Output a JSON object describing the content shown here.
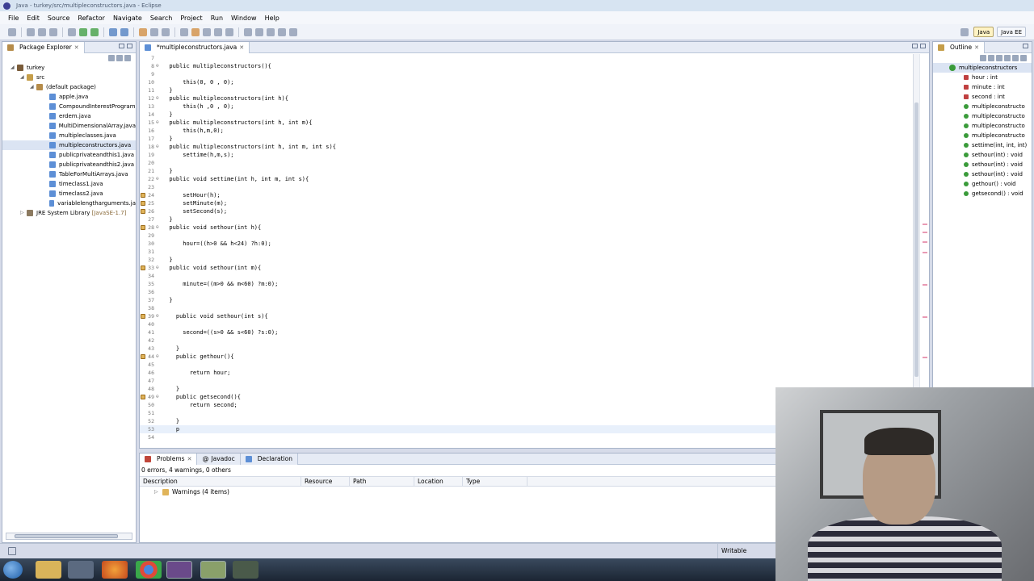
{
  "window": {
    "title": "Java - turkey/src/multipleconstructors.java - Eclipse"
  },
  "menu": [
    "File",
    "Edit",
    "Source",
    "Refactor",
    "Navigate",
    "Search",
    "Project",
    "Run",
    "Window",
    "Help"
  ],
  "perspectives": {
    "java": "Java",
    "javaee": "Java EE"
  },
  "package_explorer": {
    "tab": "Package Explorer",
    "project": "turkey",
    "src": "src",
    "default_package": "(default package)",
    "files": [
      "apple.java",
      "CompoundInterestProgram",
      "erdem.java",
      "MultiDimensionalArray.java",
      "multipleclasses.java",
      "multipleconstructors.java",
      "publicprivateandthis1.java",
      "publicprivateandthis2.java",
      "TableForMultiArrays.java",
      "timeclass1.java",
      "timeclass2.java",
      "variablelengtharguments.ja"
    ],
    "selected_index": 5,
    "library": "JRE System Library",
    "library_version": "[JavaSE-1.7]"
  },
  "editor": {
    "tab": "*multipleconstructors.java",
    "lines": [
      {
        "n": "7",
        "t": ""
      },
      {
        "n": "8",
        "t": "  public multipleconstructors(){",
        "fold": true
      },
      {
        "n": "9",
        "t": ""
      },
      {
        "n": "10",
        "t": "      this(0, 0 , 0);"
      },
      {
        "n": "11",
        "t": "  }"
      },
      {
        "n": "12",
        "t": "  public multipleconstructors(int h){",
        "fold": true
      },
      {
        "n": "13",
        "t": "      this(h ,0 , 0);"
      },
      {
        "n": "14",
        "t": "  }"
      },
      {
        "n": "15",
        "t": "  public multipleconstructors(int h, int m){",
        "fold": true
      },
      {
        "n": "16",
        "t": "      this(h,m,0);"
      },
      {
        "n": "17",
        "t": "  }"
      },
      {
        "n": "18",
        "t": "  public multipleconstructors(int h, int m, int s){",
        "fold": true
      },
      {
        "n": "19",
        "t": "      settime(h,m,s);"
      },
      {
        "n": "20",
        "t": ""
      },
      {
        "n": "21",
        "t": "  }"
      },
      {
        "n": "22",
        "t": "  public void settime(int h, int m, int s){",
        "fold": true
      },
      {
        "n": "23",
        "t": ""
      },
      {
        "n": "24",
        "t": "      setHour(h);",
        "warn": true
      },
      {
        "n": "25",
        "t": "      setMinute(m);",
        "warn": true
      },
      {
        "n": "26",
        "t": "      setSecond(s);",
        "warn": true
      },
      {
        "n": "27",
        "t": "  }"
      },
      {
        "n": "28",
        "t": "  public void sethour(int h){",
        "fold": true,
        "warn": true
      },
      {
        "n": "29",
        "t": ""
      },
      {
        "n": "30",
        "t": "      hour=((h>0 && h<24) ?h:0);"
      },
      {
        "n": "31",
        "t": ""
      },
      {
        "n": "32",
        "t": "  }"
      },
      {
        "n": "33",
        "t": "  public void sethour(int m){",
        "fold": true,
        "warn": true
      },
      {
        "n": "34",
        "t": ""
      },
      {
        "n": "35",
        "t": "      minute=((m>0 && m<60) ?m:0);"
      },
      {
        "n": "36",
        "t": ""
      },
      {
        "n": "37",
        "t": "  }"
      },
      {
        "n": "38",
        "t": ""
      },
      {
        "n": "39",
        "t": "    public void sethour(int s){",
        "fold": true,
        "warn": true
      },
      {
        "n": "40",
        "t": ""
      },
      {
        "n": "41",
        "t": "      second=((s>0 && s<60) ?s:0);"
      },
      {
        "n": "42",
        "t": ""
      },
      {
        "n": "43",
        "t": "    }"
      },
      {
        "n": "44",
        "t": "    public gethour(){",
        "fold": true,
        "warn": true
      },
      {
        "n": "45",
        "t": ""
      },
      {
        "n": "46",
        "t": "        return hour;"
      },
      {
        "n": "47",
        "t": ""
      },
      {
        "n": "48",
        "t": "    }"
      },
      {
        "n": "49",
        "t": "    public getsecond(){",
        "fold": true,
        "warn": true
      },
      {
        "n": "50",
        "t": "        return second;"
      },
      {
        "n": "51",
        "t": ""
      },
      {
        "n": "52",
        "t": "    }"
      },
      {
        "n": "53",
        "t": "    p",
        "current": true
      },
      {
        "n": "54",
        "t": ""
      }
    ]
  },
  "outline": {
    "tab": "Outline",
    "root": "multipleconstructors",
    "items": [
      {
        "label": "hour : int",
        "color": "#c04040"
      },
      {
        "label": "minute : int",
        "color": "#c04040"
      },
      {
        "label": "second : int",
        "color": "#c04040"
      },
      {
        "label": "multipleconstructo",
        "color": "#3a9b3a"
      },
      {
        "label": "multipleconstructo",
        "color": "#3a9b3a"
      },
      {
        "label": "multipleconstructo",
        "color": "#3a9b3a"
      },
      {
        "label": "multipleconstructo",
        "color": "#3a9b3a"
      },
      {
        "label": "settime(int, int, int)",
        "color": "#3a9b3a"
      },
      {
        "label": "sethour(int) : void",
        "color": "#3a9b3a"
      },
      {
        "label": "sethour(int) : void",
        "color": "#3a9b3a"
      },
      {
        "label": "sethour(int) : void",
        "color": "#3a9b3a"
      },
      {
        "label": "gethour() : void",
        "color": "#3a9b3a"
      },
      {
        "label": "getsecond() : void",
        "color": "#3a9b3a"
      }
    ]
  },
  "problems": {
    "tabs": [
      "Problems",
      "Javadoc",
      "Declaration"
    ],
    "summary": "0 errors, 4 warnings, 0 others",
    "columns": [
      "Description",
      "Resource",
      "Path",
      "Location",
      "Type"
    ],
    "row": "Warnings (4 items)"
  },
  "status": {
    "writable": "Writable"
  },
  "colors": {
    "keyword": "#7f0055",
    "selection": "#dbe4f3",
    "warning": "#e0b45a"
  }
}
